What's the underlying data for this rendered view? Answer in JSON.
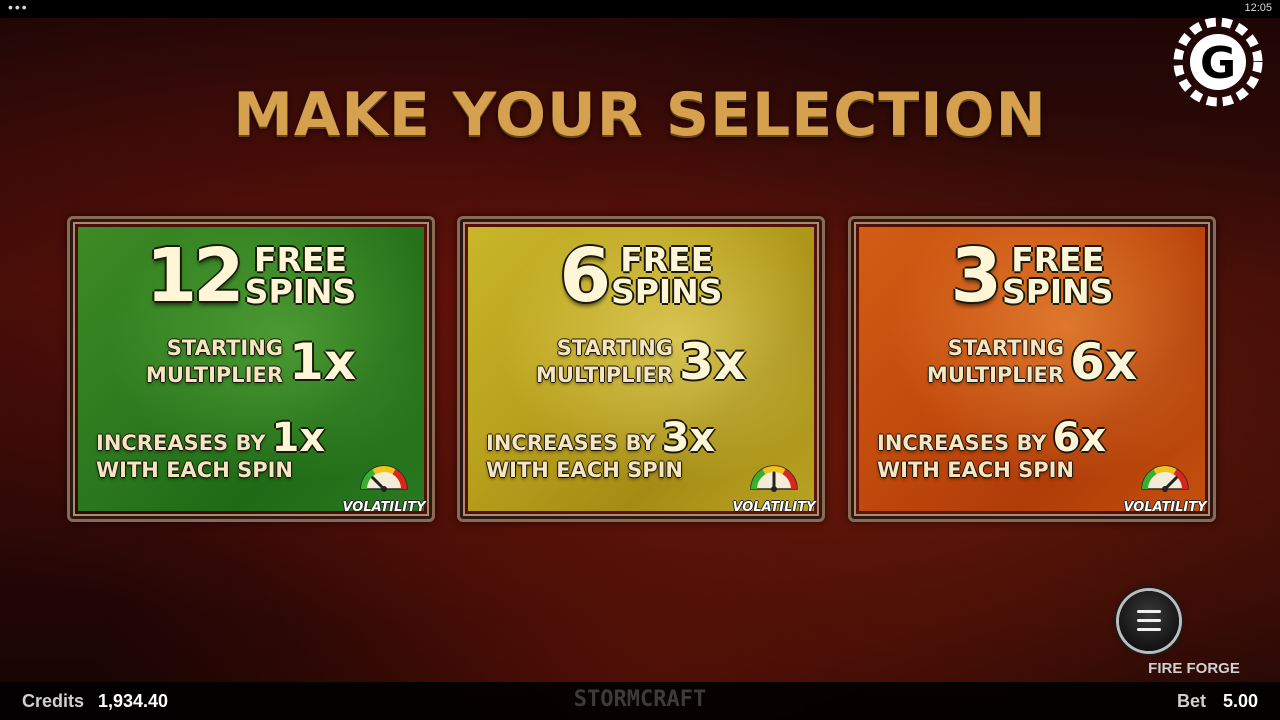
{
  "statusbar": {
    "dots": "•••",
    "time": "12:05"
  },
  "title": "MAKE YOUR SELECTION",
  "options": [
    {
      "spins": "12",
      "free": "FREE",
      "spins_word": "SPINS",
      "starting": "STARTING",
      "multiplier": "MULTIPLIER",
      "start_mult": "1x",
      "increases_by": "INCREASES BY",
      "with_each_spin": "WITH EACH SPIN",
      "increase": "1x",
      "volatility_label": "VOLATILITY",
      "volatility_level": 0.25,
      "color": "#2c7a1e"
    },
    {
      "spins": "6",
      "free": "FREE",
      "spins_word": "SPINS",
      "starting": "STARTING",
      "multiplier": "MULTIPLIER",
      "start_mult": "3x",
      "increases_by": "INCREASES BY",
      "with_each_spin": "WITH EACH SPIN",
      "increase": "3x",
      "volatility_label": "VOLATILITY",
      "volatility_level": 0.5,
      "color": "#b8a01c"
    },
    {
      "spins": "3",
      "free": "FREE",
      "spins_word": "SPINS",
      "starting": "STARTING",
      "multiplier": "MULTIPLIER",
      "start_mult": "6x",
      "increases_by": "INCREASES BY",
      "with_each_spin": "WITH EACH SPIN",
      "increase": "6x",
      "volatility_label": "VOLATILITY",
      "volatility_level": 0.75,
      "color": "#c24a0c"
    }
  ],
  "menu": {
    "icon": "hamburger-icon",
    "game_name": "FIRE FORGE"
  },
  "footer": {
    "credits_label": "Credits",
    "credits_value": "1,934.40",
    "brand": "STORMCRAFT",
    "bet_label": "Bet",
    "bet_value": "5.00"
  },
  "colors": {
    "title": "#d6a14e",
    "logo": "#ffffff"
  }
}
